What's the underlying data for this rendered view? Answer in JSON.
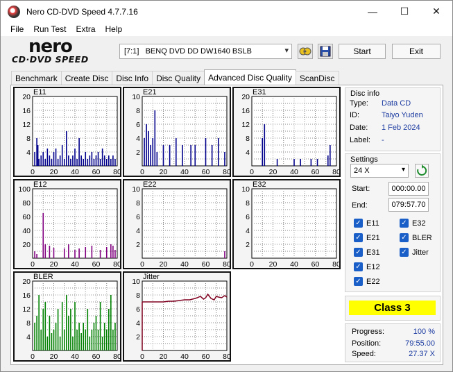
{
  "window": {
    "title": "Nero CD-DVD Speed 4.7.7.16",
    "min": "—",
    "max": "☐",
    "close": "✕"
  },
  "menu": [
    "File",
    "Run Test",
    "Extra",
    "Help"
  ],
  "logo": {
    "top": "nero",
    "bottom": "CD·DVD SPEED"
  },
  "drive": {
    "selected": "[7:1]   BENQ DVD DD DW1640 BSLB"
  },
  "buttons": {
    "start": "Start",
    "exit": "Exit"
  },
  "tabs": [
    "Benchmark",
    "Create Disc",
    "Disc Info",
    "Disc Quality",
    "Advanced Disc Quality",
    "ScanDisc"
  ],
  "active_tab": "Advanced Disc Quality",
  "graphs": [
    {
      "id": "E11",
      "label": "E11",
      "yticks": [
        "20",
        "16",
        "12",
        "8",
        "4"
      ],
      "xticks": [
        "0",
        "20",
        "40",
        "60",
        "80"
      ],
      "color": "#00008b"
    },
    {
      "id": "E21",
      "label": "E21",
      "yticks": [
        "10",
        "8",
        "6",
        "4",
        "2"
      ],
      "xticks": [
        "0",
        "20",
        "40",
        "60",
        "80"
      ],
      "color": "#00008b"
    },
    {
      "id": "E31",
      "label": "E31",
      "yticks": [
        "20",
        "16",
        "12",
        "8",
        "4"
      ],
      "xticks": [
        "0",
        "20",
        "40",
        "60",
        "80"
      ],
      "color": "#00008b"
    },
    {
      "id": "E12",
      "label": "E12",
      "yticks": [
        "100",
        "80",
        "60",
        "40",
        "20"
      ],
      "xticks": [
        "0",
        "20",
        "40",
        "60",
        "80"
      ],
      "color": "#800080"
    },
    {
      "id": "E22",
      "label": "E22",
      "yticks": [
        "10",
        "8",
        "6",
        "4",
        "2"
      ],
      "xticks": [
        "0",
        "20",
        "40",
        "60",
        "80"
      ],
      "color": "#800080"
    },
    {
      "id": "E32",
      "label": "E32",
      "yticks": [
        "10",
        "8",
        "6",
        "4",
        "2"
      ],
      "xticks": [
        "0",
        "20",
        "40",
        "60",
        "80"
      ],
      "color": "#800080"
    },
    {
      "id": "BLER",
      "label": "BLER",
      "yticks": [
        "20",
        "16",
        "12",
        "8",
        "4"
      ],
      "xticks": [
        "0",
        "20",
        "40",
        "60",
        "80"
      ],
      "color": "#008000"
    },
    {
      "id": "Jitter",
      "label": "Jitter",
      "yticks": [
        "10",
        "8",
        "6",
        "4",
        "2"
      ],
      "xticks": [
        "0",
        "20",
        "40",
        "60",
        "80"
      ],
      "color": "#800020"
    }
  ],
  "disc_info": {
    "title": "Disc info",
    "type_label": "Type:",
    "type": "Data CD",
    "id_label": "ID:",
    "id": "Taiyo Yuden",
    "date_label": "Date:",
    "date": "1 Feb 2024",
    "label_label": "Label:",
    "label": "-"
  },
  "settings": {
    "title": "Settings",
    "speed": "24 X",
    "start_label": "Start:",
    "start": "000:00.00",
    "end_label": "End:",
    "end": "079:57.70",
    "checks": [
      {
        "name": "E11",
        "checked": true
      },
      {
        "name": "E32",
        "checked": true
      },
      {
        "name": "E21",
        "checked": true
      },
      {
        "name": "BLER",
        "checked": true
      },
      {
        "name": "E31",
        "checked": true
      },
      {
        "name": "Jitter",
        "checked": true
      },
      {
        "name": "E12",
        "checked": true
      },
      {
        "name": "E22",
        "checked": true
      }
    ]
  },
  "result": {
    "class": "Class 3"
  },
  "progress": {
    "progress_label": "Progress:",
    "progress": "100 %",
    "position_label": "Position:",
    "position": "79:55.00",
    "speed_label": "Speed:",
    "speed": "27.37 X"
  },
  "chart_data": [
    {
      "type": "bar",
      "title": "E11",
      "ylim": [
        0,
        20
      ],
      "x_range": [
        0,
        80
      ],
      "x": [
        2,
        4,
        5,
        6,
        8,
        10,
        12,
        14,
        16,
        18,
        20,
        22,
        24,
        26,
        28,
        30,
        32,
        34,
        36,
        38,
        40,
        42,
        44,
        46,
        48,
        50,
        52,
        54,
        56,
        58,
        60,
        62,
        64,
        66,
        68,
        70,
        72,
        74,
        76,
        78
      ],
      "values": [
        4,
        8,
        6,
        2,
        3,
        4,
        2,
        5,
        3,
        2,
        4,
        5,
        2,
        3,
        6,
        2,
        10,
        3,
        2,
        3,
        5,
        2,
        8,
        3,
        2,
        4,
        2,
        3,
        4,
        2,
        3,
        4,
        2,
        5,
        3,
        2,
        3,
        2,
        3,
        2
      ]
    },
    {
      "type": "bar",
      "title": "E21",
      "ylim": [
        0,
        10
      ],
      "x_range": [
        0,
        80
      ],
      "x": [
        2,
        4,
        6,
        8,
        10,
        12,
        14,
        20,
        26,
        32,
        38,
        46,
        50,
        60,
        66,
        72,
        78
      ],
      "values": [
        4,
        6,
        5,
        3,
        4,
        8,
        2,
        3,
        3,
        4,
        3,
        3,
        3,
        4,
        3,
        4,
        2
      ]
    },
    {
      "type": "bar",
      "title": "E31",
      "ylim": [
        0,
        20
      ],
      "x_range": [
        0,
        80
      ],
      "x": [
        10,
        12,
        24,
        40,
        46,
        56,
        62,
        72,
        74
      ],
      "values": [
        8,
        12,
        2,
        2,
        2,
        2,
        2,
        3,
        6
      ]
    },
    {
      "type": "bar",
      "title": "E12",
      "ylim": [
        0,
        100
      ],
      "x_range": [
        0,
        80
      ],
      "x": [
        2,
        4,
        10,
        12,
        16,
        20,
        30,
        34,
        40,
        44,
        50,
        56,
        64,
        70,
        74,
        76,
        78
      ],
      "values": [
        10,
        6,
        65,
        20,
        18,
        15,
        14,
        20,
        12,
        14,
        16,
        18,
        12,
        16,
        20,
        18,
        12
      ]
    },
    {
      "type": "bar",
      "title": "E22",
      "ylim": [
        0,
        10
      ],
      "x_range": [
        0,
        80
      ],
      "x": [
        78
      ],
      "values": [
        1
      ]
    },
    {
      "type": "bar",
      "title": "E32",
      "ylim": [
        0,
        10
      ],
      "x_range": [
        0,
        80
      ],
      "x": [],
      "values": []
    },
    {
      "type": "bar",
      "title": "BLER",
      "ylim": [
        0,
        20
      ],
      "x_range": [
        0,
        80
      ],
      "x": [
        2,
        4,
        6,
        8,
        10,
        12,
        14,
        16,
        18,
        20,
        22,
        24,
        26,
        28,
        30,
        32,
        34,
        36,
        38,
        40,
        42,
        44,
        46,
        48,
        50,
        52,
        54,
        56,
        58,
        60,
        62,
        64,
        66,
        68,
        70,
        72,
        74,
        76,
        78
      ],
      "values": [
        8,
        10,
        16,
        6,
        12,
        14,
        4,
        10,
        5,
        6,
        8,
        12,
        4,
        14,
        6,
        16,
        10,
        12,
        4,
        14,
        6,
        8,
        5,
        8,
        6,
        12,
        4,
        6,
        8,
        10,
        6,
        14,
        4,
        8,
        6,
        12,
        16,
        6,
        8
      ]
    },
    {
      "type": "line",
      "title": "Jitter",
      "ylim": [
        0,
        10
      ],
      "x_range": [
        0,
        80
      ],
      "x": [
        0,
        5,
        10,
        15,
        20,
        25,
        30,
        35,
        40,
        45,
        50,
        52,
        55,
        58,
        60,
        62,
        65,
        68,
        70,
        72,
        75,
        78,
        80
      ],
      "values": [
        7,
        7,
        7,
        7,
        7,
        7.1,
        7.1,
        7.2,
        7.3,
        7.3,
        7.5,
        7.6,
        7.8,
        7.4,
        7.6,
        8.1,
        7.5,
        7.3,
        7.8,
        7.7,
        7.6,
        7.9,
        7.7
      ]
    }
  ]
}
